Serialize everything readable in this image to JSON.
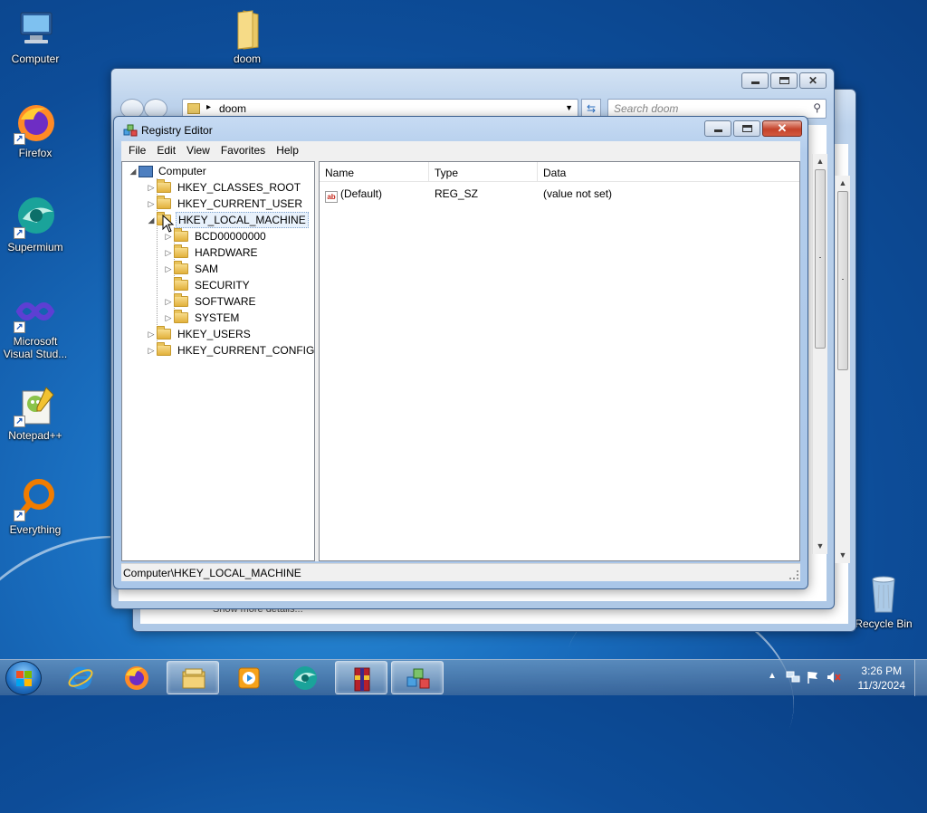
{
  "desktop": {
    "icons": [
      {
        "label": "Computer",
        "icon": "computer-icon"
      },
      {
        "label": "doom",
        "icon": "folder-icon"
      },
      {
        "label": "Firefox",
        "icon": "firefox-icon"
      },
      {
        "label": "Supermium",
        "icon": "supermium-icon"
      },
      {
        "label": "Microsoft Visual Stud...",
        "icon": "visual-studio-icon"
      },
      {
        "label": "Notepad++",
        "icon": "notepad-plus-plus-icon"
      },
      {
        "label": "Everything",
        "icon": "everything-search-icon"
      },
      {
        "label": "Recycle Bin",
        "icon": "recycle-bin-icon"
      }
    ]
  },
  "explorer": {
    "path": "doom",
    "search_placeholder": "Search doom",
    "details_text": "Show more details..."
  },
  "regedit": {
    "title": "Registry Editor",
    "menu": [
      "File",
      "Edit",
      "View",
      "Favorites",
      "Help"
    ],
    "tree": {
      "root": "Computer",
      "hives": [
        "HKEY_CLASSES_ROOT",
        "HKEY_CURRENT_USER",
        "HKEY_LOCAL_MACHINE",
        "HKEY_USERS",
        "HKEY_CURRENT_CONFIG"
      ],
      "selected": "HKEY_LOCAL_MACHINE",
      "hklm_children": [
        "BCD00000000",
        "HARDWARE",
        "SAM",
        "SECURITY",
        "SOFTWARE",
        "SYSTEM"
      ]
    },
    "columns": [
      "Name",
      "Type",
      "Data"
    ],
    "values": [
      {
        "name": "(Default)",
        "type": "REG_SZ",
        "data": "(value not set)"
      }
    ],
    "status": "Computer\\HKEY_LOCAL_MACHINE"
  },
  "taskbar": {
    "apps": [
      "internet-explorer",
      "firefox",
      "file-explorer",
      "media-player",
      "supermium",
      "winrar",
      "registry-editor"
    ],
    "active_app": "registry-editor",
    "time": "3:26 PM",
    "date": "11/3/2024"
  }
}
